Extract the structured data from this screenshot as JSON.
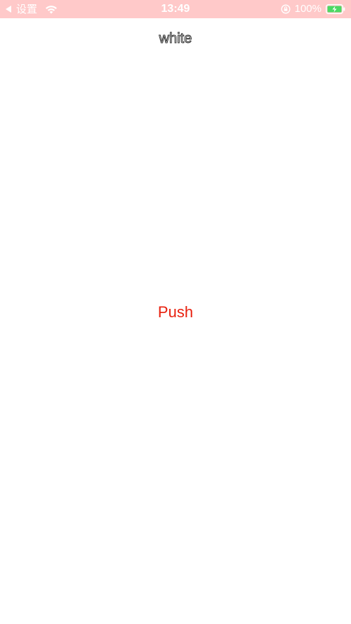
{
  "status_bar": {
    "back_label": "设置",
    "time": "13:49",
    "battery_percent": "100%",
    "background_color": "#ffc9c9",
    "icons": [
      "back-triangle-icon",
      "wifi-icon",
      "orientation-lock-icon",
      "battery-charging-icon"
    ]
  },
  "nav": {
    "title": "white"
  },
  "main": {
    "push_label": "Push",
    "push_color": "#e8200e"
  }
}
